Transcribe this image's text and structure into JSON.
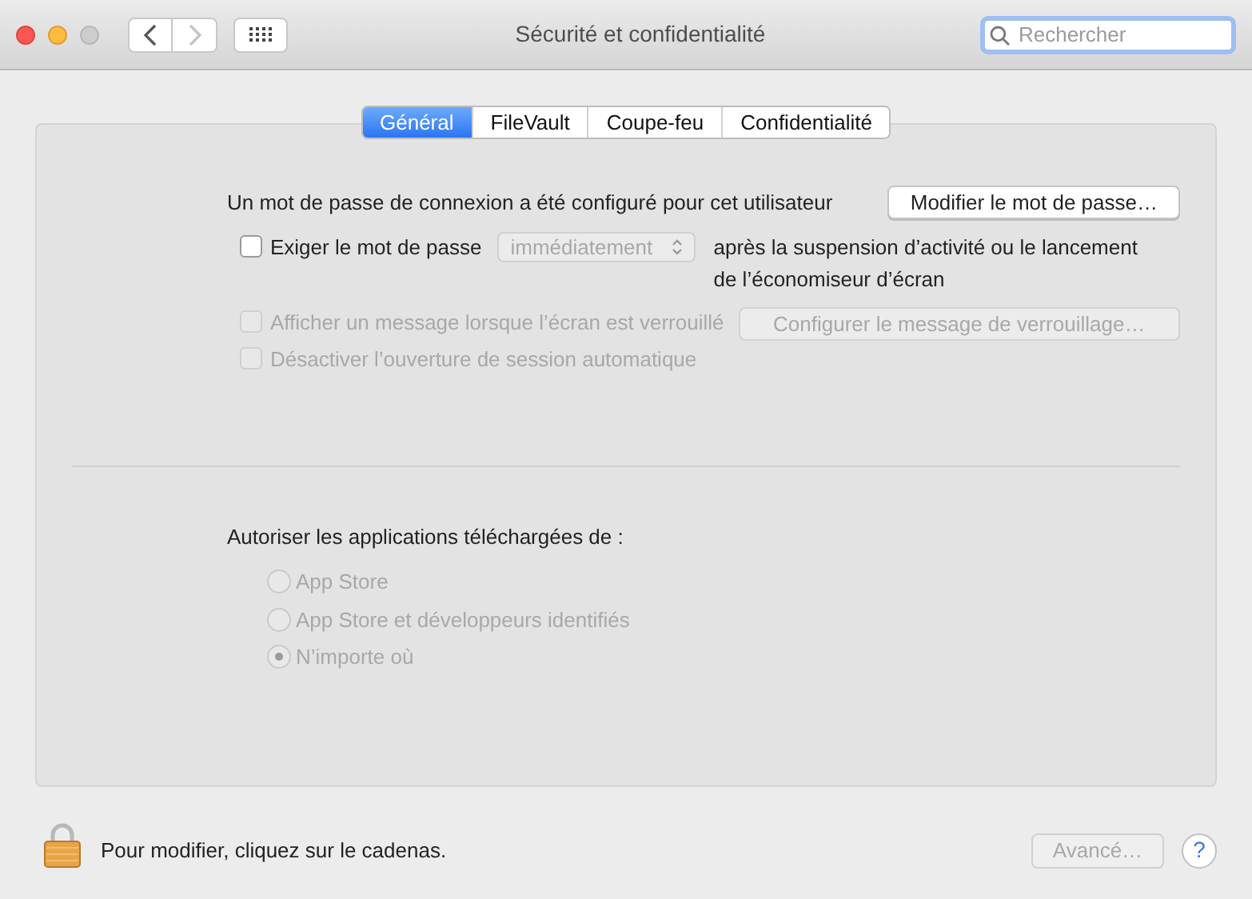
{
  "window": {
    "title": "Sécurité et confidentialité"
  },
  "nav": [
    {
      "kind": "back",
      "disabled": false
    },
    {
      "kind": "forward",
      "disabled": true
    }
  ],
  "search": {
    "placeholder": "Rechercher"
  },
  "tabs": [
    {
      "label": "Général",
      "selected": true
    },
    {
      "label": "FileVault",
      "selected": false
    },
    {
      "label": "Coupe-feu",
      "selected": false
    },
    {
      "label": "Confidentialité",
      "selected": false
    }
  ],
  "general": {
    "password_status": "Un mot de passe de connexion a été configuré pour cet utilisateur",
    "change_password_button": "Modifier le mot de passe…",
    "options": [
      {
        "kind": "require",
        "label": "Exiger le mot de passe",
        "checked": false,
        "disabled": false,
        "popup": {
          "value": "immédiatement",
          "disabled": true
        },
        "suffix": "après la suspension d’activité ou le lancement de l’économiseur d’écran"
      },
      {
        "kind": "message",
        "label": "Afficher un message lorsque l’écran est verrouillé",
        "checked": false,
        "disabled": true,
        "button": "Configurer le message de verrouillage…"
      },
      {
        "kind": "plain",
        "label": "Désactiver l’ouverture de session automatique",
        "checked": false,
        "disabled": true
      }
    ],
    "allow_heading": "Autoriser les applications téléchargées de :",
    "sources": [
      {
        "label": "App Store",
        "selected": false,
        "disabled": true
      },
      {
        "label": "App Store et développeurs identifiés",
        "selected": false,
        "disabled": true
      },
      {
        "label": "N’importe où",
        "selected": true,
        "disabled": true
      }
    ]
  },
  "footer": {
    "lock_hint": "Pour modifier, cliquez sur le cadenas.",
    "advanced_button": {
      "label": "Avancé…",
      "disabled": true
    },
    "help": "?"
  }
}
